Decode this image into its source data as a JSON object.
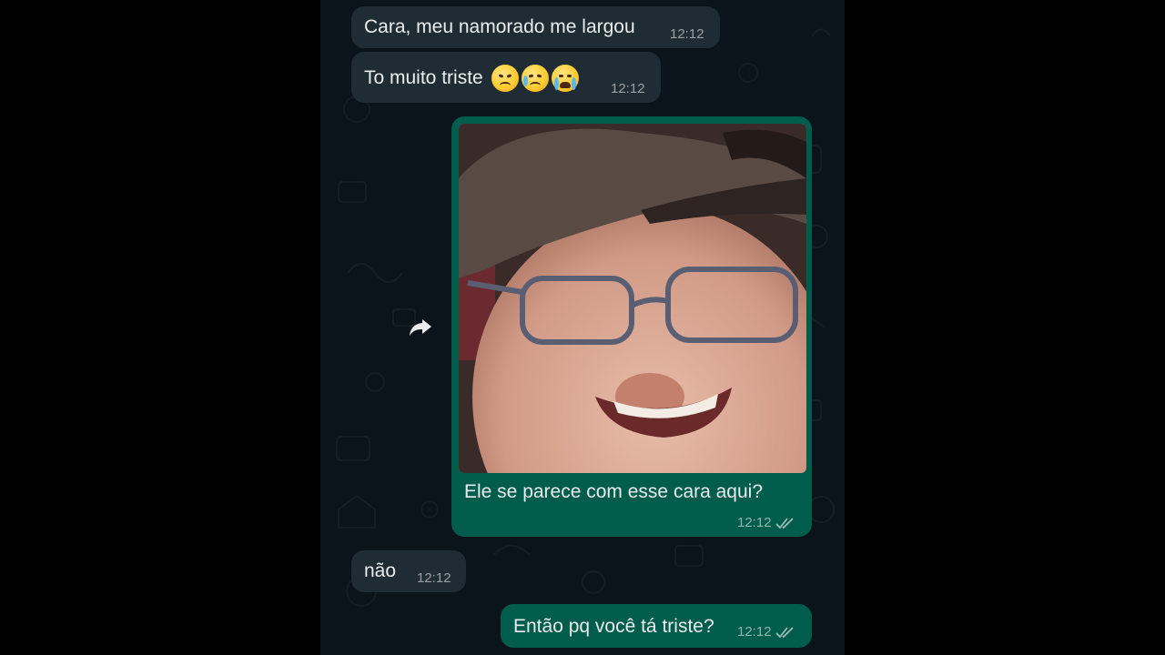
{
  "messages": [
    {
      "direction": "incoming",
      "text": "Cara, meu namorado me largou",
      "time": "12:12"
    },
    {
      "direction": "incoming",
      "text": "To muito triste",
      "emojis": [
        "disappointed-face-emoji",
        "sad-but-relieved-face-emoji",
        "loudly-crying-face-emoji"
      ],
      "time": "12:12"
    },
    {
      "direction": "outgoing",
      "image": "photo-smiling-man-with-cap-and-glasses",
      "caption": "Ele se parece com esse cara aqui?",
      "time": "12:12",
      "status": "read"
    },
    {
      "direction": "incoming",
      "text": "não",
      "time": "12:12"
    },
    {
      "direction": "outgoing",
      "text": "Então pq você tá triste?",
      "time": "12:12",
      "status": "read"
    }
  ],
  "icons": {
    "forward": "forward-arrow-icon",
    "read_receipt": "double-check-icon"
  },
  "colors": {
    "chat_background": "#0b141a",
    "incoming_bubble": "#202c33",
    "outgoing_bubble": "#005c4b",
    "text": "#e9edef",
    "outer_background": "#000000"
  }
}
